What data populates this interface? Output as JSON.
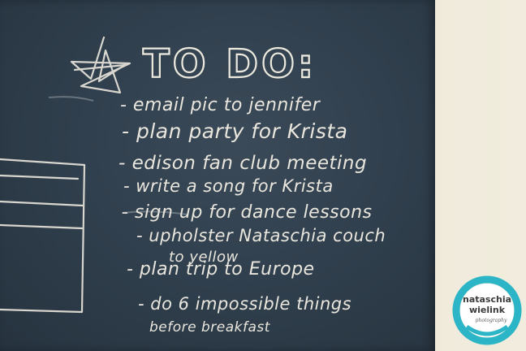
{
  "title": "TO DO:",
  "items": [
    "- email pic to jennifer",
    "- plan party for Krista",
    "- edison fan club meeting",
    "- write a song for Krista",
    "- sign up for dance lessons",
    "- upholster Nataschia couch",
    "to yellow",
    "- plan trip to Europe",
    "- do 6 impossible things",
    "before breakfast"
  ],
  "logo": {
    "line1": "nataschia",
    "line2": "wielink",
    "line3": "photography"
  },
  "colors": {
    "chalkboard": "#31404e",
    "chalk": "#e9e6dd",
    "wall": "#ece7d6",
    "logo_accent": "#2bb5c6"
  }
}
